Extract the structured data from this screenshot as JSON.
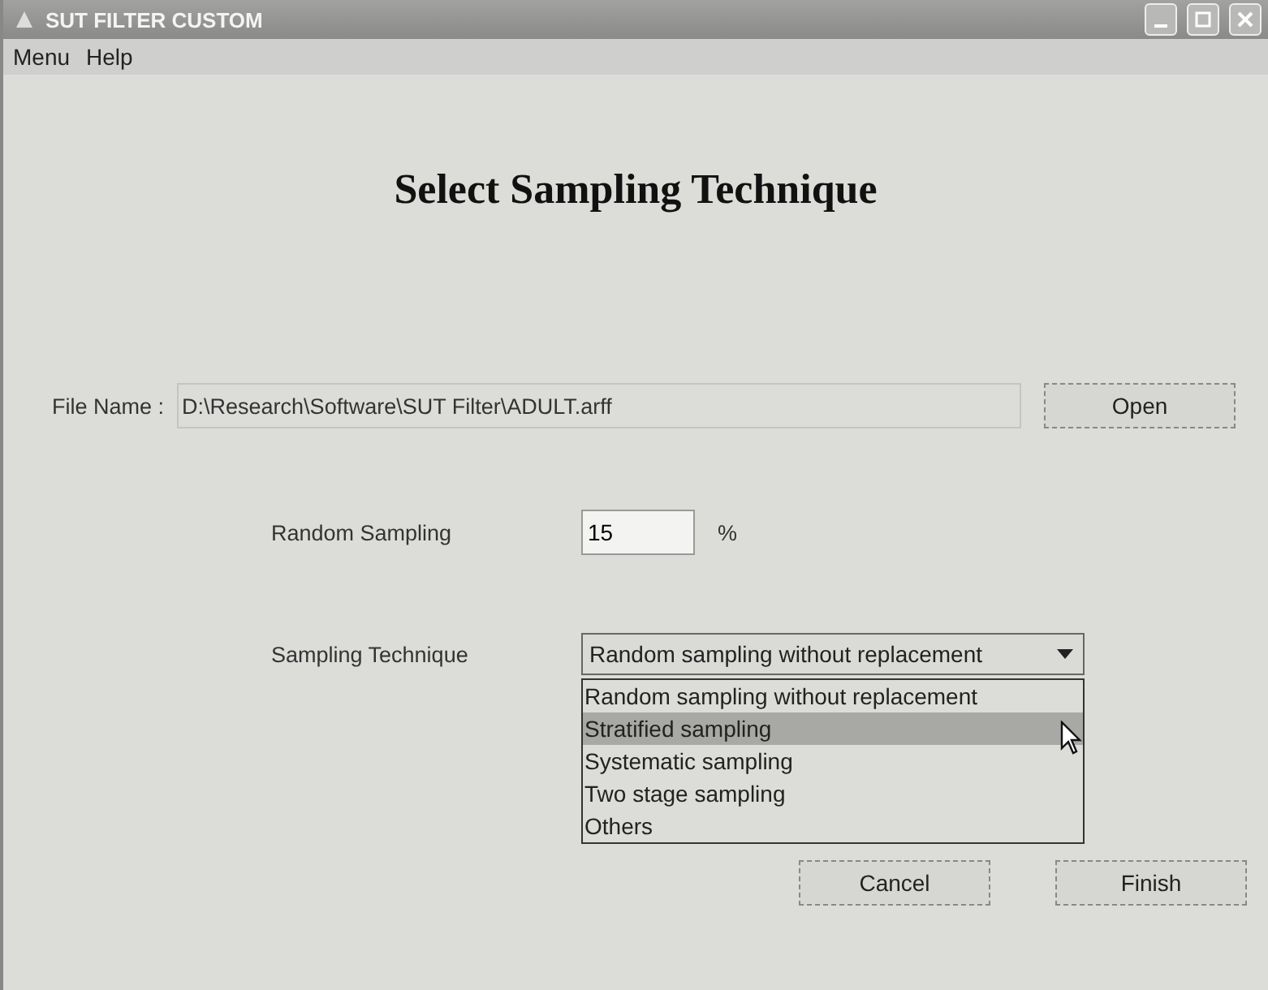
{
  "window": {
    "title": "SUT FILTER CUSTOM"
  },
  "menu": [
    "Menu",
    "Help"
  ],
  "heading": "Select Sampling Technique",
  "file": {
    "label": "File Name :",
    "value": "D:\\Research\\Software\\SUT Filter\\ADULT.arff",
    "button": "Open"
  },
  "random_sampling": {
    "label": "Random Sampling",
    "value": "15",
    "unit": "%"
  },
  "sampling_technique": {
    "label": "Sampling Technique",
    "value": "Random sampling without replacement",
    "expanded": true,
    "options": [
      {
        "label": "Random sampling without replacement",
        "highlighted": false
      },
      {
        "label": "Stratified sampling",
        "highlighted": true
      },
      {
        "label": "Systematic sampling",
        "highlighted": false
      },
      {
        "label": "Two stage sampling",
        "highlighted": false
      },
      {
        "label": "Others",
        "highlighted": false
      }
    ]
  },
  "buttons": [
    "Cancel",
    "Finish"
  ]
}
